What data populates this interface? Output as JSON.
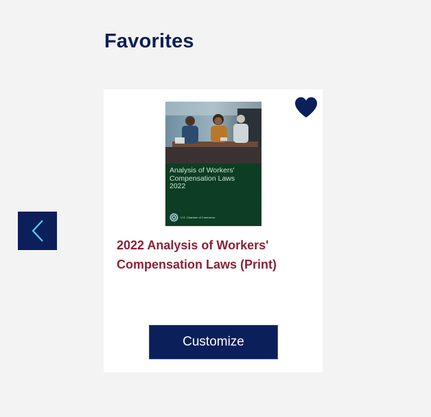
{
  "section": {
    "title": "Favorites"
  },
  "carousel": {
    "prev_icon": "chevron-left-icon"
  },
  "card": {
    "favorite_icon": "heart-icon",
    "favorited": true,
    "cover": {
      "title": "Analysis of Workers'\nCompensation Laws\n2022",
      "publisher": "U.S. Chamber of Commerce",
      "colors": {
        "background": "#0d3d24",
        "text": "#cfe3d6"
      }
    },
    "product_title": "2022 Analysis of Workers' Compensation Laws (Print)",
    "customize_label": "Customize"
  },
  "colors": {
    "navy": "#0b1f5b",
    "title_navy": "#0b1f55",
    "link_red": "#8a2236",
    "accent_cyan": "#4fd6f0",
    "page_background": "#f3f3f3"
  }
}
